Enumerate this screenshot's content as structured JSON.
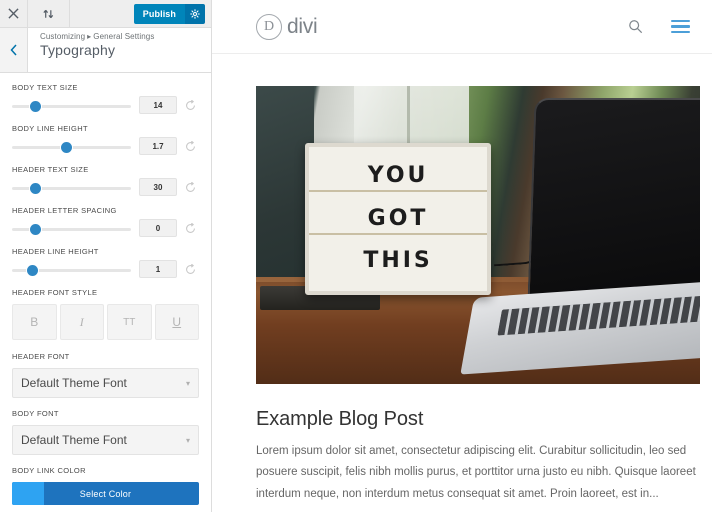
{
  "customizer": {
    "topbar": {
      "close_icon": "close-icon",
      "devices_icon": "device-switch-icon",
      "publish_label": "Publish",
      "gear_icon": "gear-icon"
    },
    "header": {
      "back_icon": "chevron-left-icon",
      "breadcrumb_root": "Customizing",
      "breadcrumb_separator": "▸",
      "breadcrumb_section": "General Settings",
      "title": "Typography"
    },
    "controls": [
      {
        "label": "BODY TEXT SIZE",
        "value": "14",
        "handle_pct": 15,
        "reset_icon": "reset-icon"
      },
      {
        "label": "BODY LINE HEIGHT",
        "value": "1.7",
        "handle_pct": 41,
        "reset_icon": "reset-icon"
      },
      {
        "label": "HEADER TEXT SIZE",
        "value": "30",
        "handle_pct": 15,
        "reset_icon": "reset-icon"
      },
      {
        "label": "HEADER LETTER SPACING",
        "value": "0",
        "handle_pct": 15,
        "reset_icon": "reset-icon"
      },
      {
        "label": "HEADER LINE HEIGHT",
        "value": "1",
        "handle_pct": 13,
        "reset_icon": "reset-icon"
      }
    ],
    "font_style": {
      "label": "HEADER FONT STYLE",
      "buttons": [
        {
          "label": "B",
          "name": "bold"
        },
        {
          "label": "I",
          "name": "italic"
        },
        {
          "label": "TT",
          "name": "uppercase"
        },
        {
          "label": "U",
          "name": "underline"
        }
      ]
    },
    "header_font": {
      "label": "HEADER FONT",
      "value": "Default Theme Font",
      "caret": "▾"
    },
    "body_font": {
      "label": "BODY FONT",
      "value": "Default Theme Font",
      "caret": "▾"
    },
    "body_link_color": {
      "label": "BODY LINK COLOR",
      "button_label": "Select Color",
      "swatch_color": "#2ea3f2",
      "button_color": "#1e73be"
    },
    "accent_color": "#0085ba"
  },
  "preview": {
    "site_header": {
      "logo_mark": "D",
      "logo_text": "divi",
      "search_icon": "search-icon",
      "menu_icon": "hamburger-menu-icon",
      "menu_color": "#4c9fd8"
    },
    "post": {
      "image_alt": "lightbox-sign-photo",
      "sign_lines": [
        "YOU",
        "GOT",
        "THIS"
      ],
      "title": "Example Blog Post",
      "excerpt": "Lorem ipsum dolor sit amet, consectetur adipiscing elit. Curabitur sollicitudin, leo sed posuere suscipit, felis nibh mollis purus, et porttitor urna justo eu nibh. Quisque laoreet interdum neque, non interdum metus consequat sit amet. Proin laoreet, est in..."
    }
  }
}
